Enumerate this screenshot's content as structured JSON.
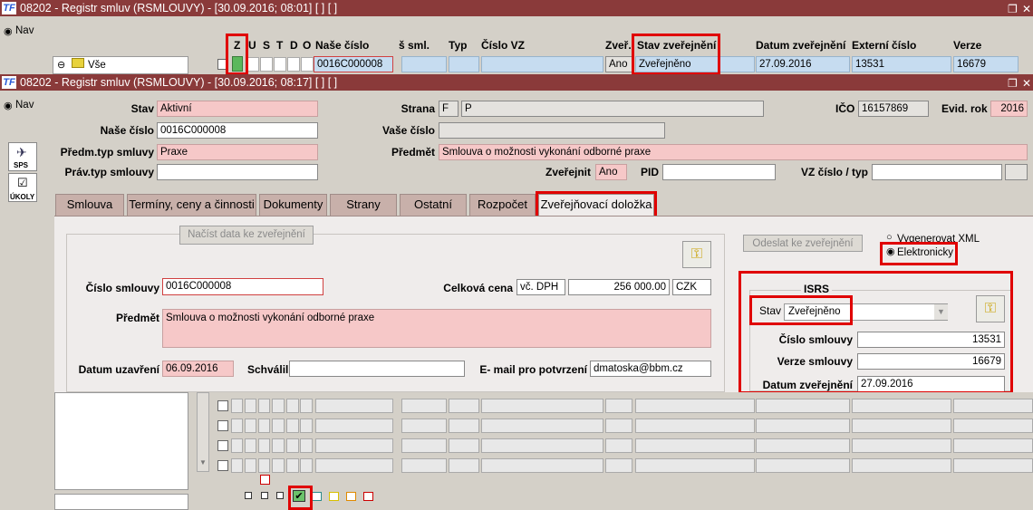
{
  "back_window": {
    "title": "08202 - Registr smluv (RSMLOUVY) - [30.09.2016; 08:01] [ ] [ ]",
    "nav_label": "Nav",
    "tree_label": "Vše",
    "columns": {
      "z": "Z",
      "u": "U",
      "s": "S",
      "t": "T",
      "d": "D",
      "o": "O",
      "nase_cislo": "Naše číslo",
      "vase_sml": "š sml.",
      "typ": "Typ",
      "cislo_vz": "Číslo VZ",
      "zver": "Zveř.",
      "stav_zver": "Stav zveřejnění",
      "datum_zver": "Datum zveřejnění",
      "externi_cislo": "Externí číslo",
      "verze": "Verze"
    },
    "row": {
      "nase_cislo": "0016C000008",
      "zver": "Ano",
      "stav_zver": "Zveřejněno",
      "datum_zver": "27.09.2016",
      "externi_cislo": "13531",
      "verze": "16679"
    }
  },
  "front_window": {
    "title": "08202 - Registr smluv (RSMLOUVY) - [30.09.2016; 08:17] [ ] [ ]",
    "nav_label": "Nav",
    "sps_label": "SPS",
    "ukoly_label": "ÚKOLY",
    "labels": {
      "stav": "Stav",
      "nase_cislo": "Naše číslo",
      "predm_typ": "Předm.typ smluvy",
      "prav_typ": "Práv.typ smlouvy",
      "strana": "Strana",
      "vase_cislo": "Vaše číslo",
      "predmet": "Předmět",
      "zverejnit": "Zveřejnit",
      "pid": "PID",
      "vz_cislo": "VZ číslo / typ",
      "ico": "IČO",
      "evid_rok": "Evid. rok"
    },
    "values": {
      "stav": "Aktivní",
      "nase_cislo": "0016C000008",
      "predm_typ": "Praxe",
      "strana_code": "F",
      "strana_name": "P",
      "predmet": "Smlouva o možnosti vykonání odborné praxe",
      "zverejnit": "Ano",
      "ico": "16157869",
      "evid_rok": "2016"
    },
    "tabs": [
      "Smlouva",
      "Termíny, ceny a činnosti",
      "Dokumenty",
      "Strany",
      "Ostatní",
      "Rozpočet",
      "Zveřejňovací doložka"
    ],
    "active_tab": "Zveřejňovací doložka",
    "panel": {
      "nacist_button": "Načíst data ke zveřejnění",
      "cislo_smlouvy_label": "Číslo smlouvy",
      "cislo_smlouvy": "0016C000008",
      "celkova_cena_label": "Celková cena",
      "dph": "vč. DPH",
      "cena": "256 000.00",
      "mena": "CZK",
      "predmet_label": "Předmět",
      "predmet": "Smlouva o možnosti vykonání odborné praxe",
      "datum_uzavreni_label": "Datum uzavření",
      "datum_uzavreni": "06.09.2016",
      "schvalil_label": "Schválil",
      "email_label": "E- mail pro potvrzení",
      "email": "dmatoska@bbm.cz"
    },
    "right_panel": {
      "odeslat_button": "Odeslat ke zveřejnění",
      "radio_xml": "Vygenerovat XML",
      "radio_el": "Elektronicky",
      "isrs_title": "ISRS",
      "stav_label": "Stav",
      "stav_value": "Zveřejněno",
      "cislo_label": "Číslo smlouvy",
      "cislo_value": "13531",
      "verze_label": "Verze smlouvy",
      "verze_value": "16679",
      "datum_label": "Datum zveřejnění",
      "datum_value": "27.09.2016"
    }
  },
  "colors": {
    "titlebar": "#8a3a3a",
    "highlight": "#e00000",
    "pink_field": "#f6c8c8",
    "blue_field": "#c6dcf0"
  },
  "icons": [
    "minimize-icon",
    "close-icon",
    "folder-icon",
    "key-icon",
    "checkmark-icon",
    "radio-icon",
    "dropdown-arrow-icon"
  ]
}
